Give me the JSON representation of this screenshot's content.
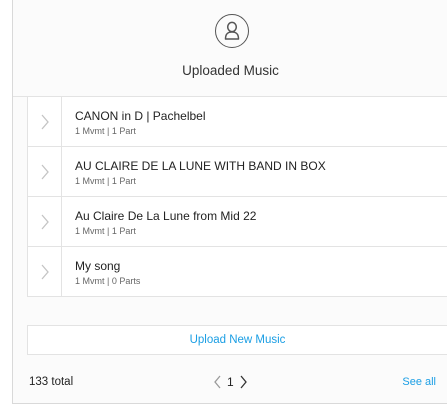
{
  "header": {
    "icon": "user-icon",
    "title": "Uploaded Music"
  },
  "list": {
    "items": [
      {
        "title": "CANON in D | Pachelbel",
        "meta": "1 Mvmt | 1 Part"
      },
      {
        "title": "AU CLAIRE DE LA LUNE WITH BAND IN BOX",
        "meta": "1 Mvmt | 1 Part"
      },
      {
        "title": "Au Claire De La Lune from Mid 22",
        "meta": "1 Mvmt | 1 Part"
      },
      {
        "title": "My song",
        "meta": "1 Mvmt | 0 Parts"
      }
    ]
  },
  "actions": {
    "upload_label": "Upload New Music"
  },
  "footer": {
    "total": "133 total",
    "page": "1",
    "see_all": "See all"
  },
  "colors": {
    "accent": "#1a9ee4",
    "border": "#e3e3e3",
    "text": "#333333"
  }
}
